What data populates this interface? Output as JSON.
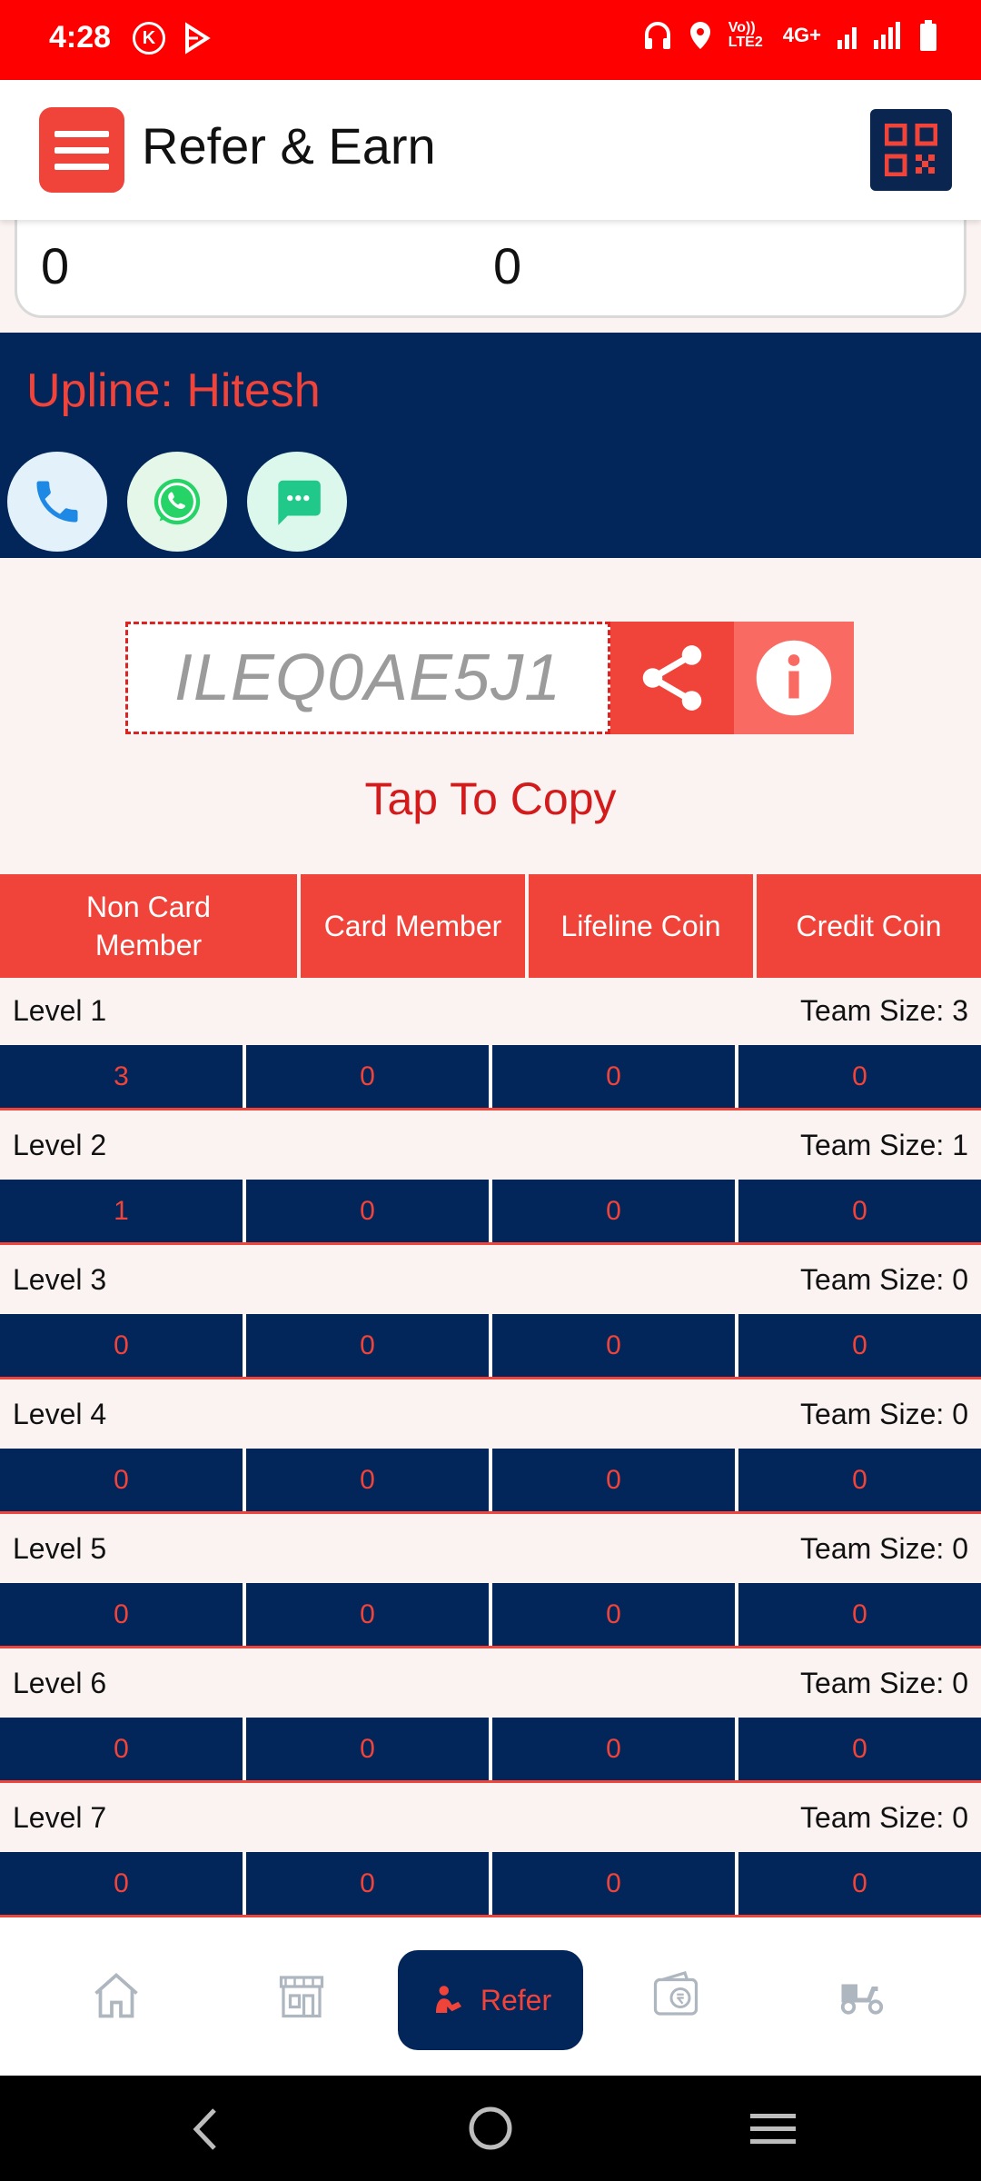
{
  "status_bar": {
    "time": "4:28",
    "left_icons": [
      "k-circle-icon",
      "play-icon"
    ],
    "right_icons": [
      "headphones-icon",
      "location-icon",
      "volte-icon",
      "signal-icon",
      "battery-icon"
    ],
    "volte_text": "Vo)) LTE2",
    "network": "4G+"
  },
  "app_bar": {
    "title": "Refer & Earn"
  },
  "stats": {
    "left_value": "0",
    "right_value": "0"
  },
  "upline": {
    "label": "Upline: Hitesh"
  },
  "referral": {
    "code": "ILEQ0AE5J1",
    "tap_to_copy": "Tap To Copy"
  },
  "table": {
    "headers": [
      "Non Card Member",
      "Card Member",
      "Lifeline Coin",
      "Credit Coin"
    ],
    "levels": [
      {
        "name": "Level 1",
        "team_size": "Team Size: 3",
        "values": [
          "3",
          "0",
          "0",
          "0"
        ]
      },
      {
        "name": "Level 2",
        "team_size": "Team Size: 1",
        "values": [
          "1",
          "0",
          "0",
          "0"
        ]
      },
      {
        "name": "Level 3",
        "team_size": "Team Size: 0",
        "values": [
          "0",
          "0",
          "0",
          "0"
        ]
      },
      {
        "name": "Level 4",
        "team_size": "Team Size: 0",
        "values": [
          "0",
          "0",
          "0",
          "0"
        ]
      },
      {
        "name": "Level 5",
        "team_size": "Team Size: 0",
        "values": [
          "0",
          "0",
          "0",
          "0"
        ]
      },
      {
        "name": "Level 6",
        "team_size": "Team Size: 0",
        "values": [
          "0",
          "0",
          "0",
          "0"
        ]
      },
      {
        "name": "Level 7",
        "team_size": "Team Size: 0",
        "values": [
          "0",
          "0",
          "0",
          "0"
        ]
      }
    ]
  },
  "bottom_nav": {
    "active_label": "Refer",
    "items": [
      "home-icon",
      "store-icon",
      "refer-icon",
      "wallet-icon",
      "scooter-icon"
    ]
  },
  "colors": {
    "accent": "#f0433a",
    "navy": "#03265a",
    "status_bar": "#ff0000",
    "background": "#faf3f2"
  }
}
